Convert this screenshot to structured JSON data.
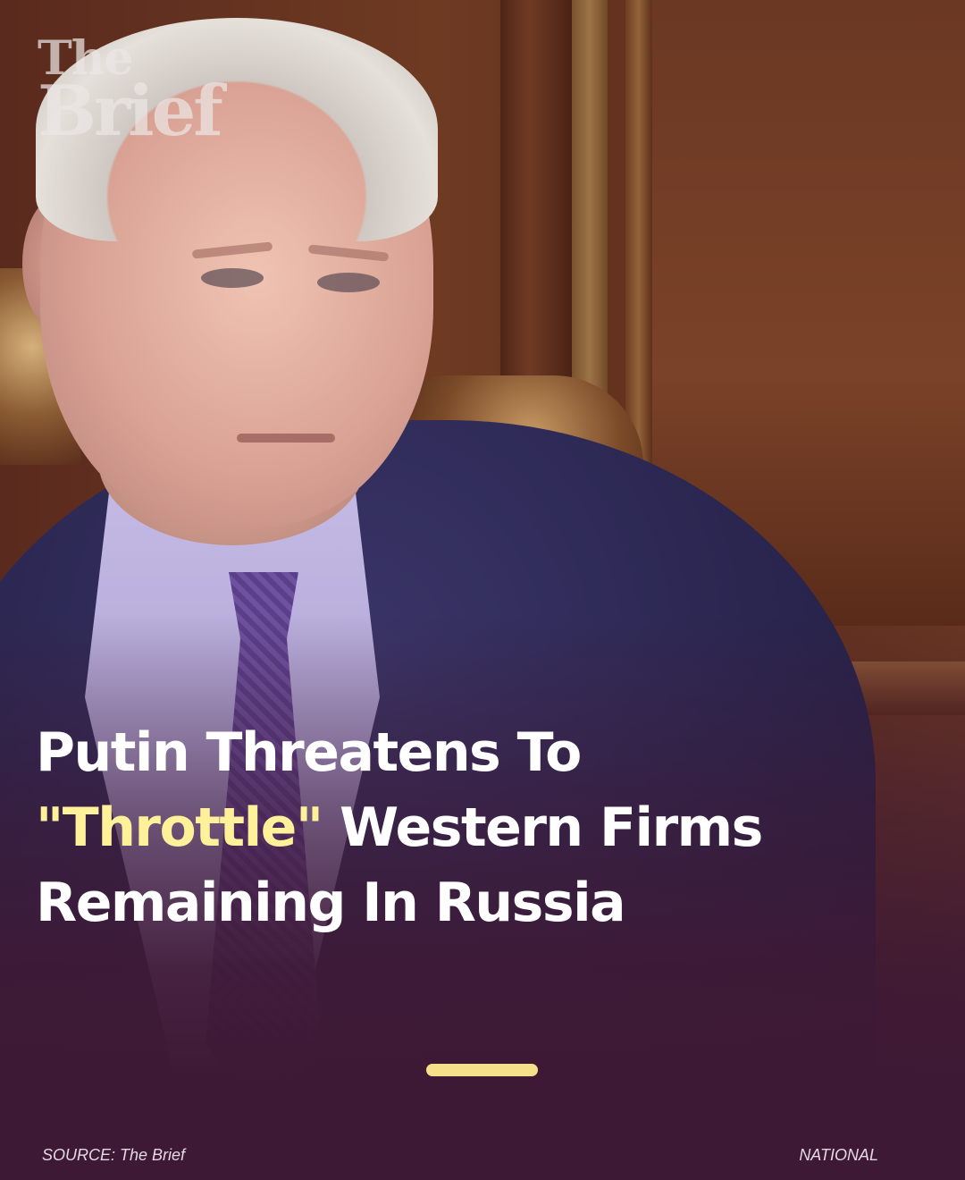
{
  "brand": {
    "logo_line1": "The",
    "logo_line2": "Brief"
  },
  "headline": {
    "line1": "Putin Threatens To",
    "line2_highlight": "\"Throttle\"",
    "line2_rest": " Western Firms",
    "line3": "Remaining In Russia"
  },
  "footer": {
    "source": "SOURCE: The Brief",
    "category": "NATIONAL"
  },
  "colors": {
    "background": "#3e1935",
    "highlight": "#fff09a",
    "divider": "#f6e08a",
    "text": "#ffffff"
  }
}
